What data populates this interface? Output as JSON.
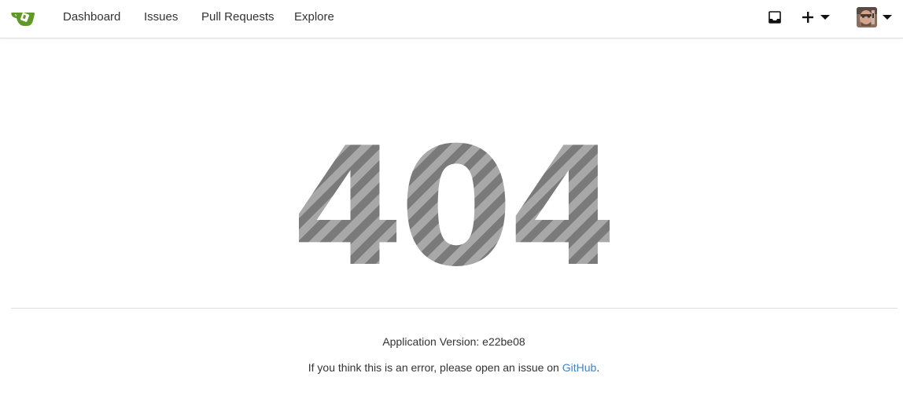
{
  "nav": {
    "items": [
      {
        "label": "Dashboard"
      },
      {
        "label": "Issues"
      },
      {
        "label": "Pull Requests"
      },
      {
        "label": "Explore"
      }
    ]
  },
  "header_right": {
    "inbox_icon": "inbox-icon",
    "create_icon": "plus-icon",
    "create_dropdown_icon": "caret-down-icon",
    "user_dropdown_icon": "caret-down-icon"
  },
  "error": {
    "code": "404",
    "version_label": "Application Version: e22be08",
    "report_prefix": "If you think this is an error, please open an issue on ",
    "report_link": "GitHub",
    "report_suffix": "."
  },
  "colors": {
    "brand_green": "#609926",
    "link_blue": "#4183c4",
    "stripe_dark": "#7a7a7a",
    "stripe_light": "#a8a8a8"
  }
}
